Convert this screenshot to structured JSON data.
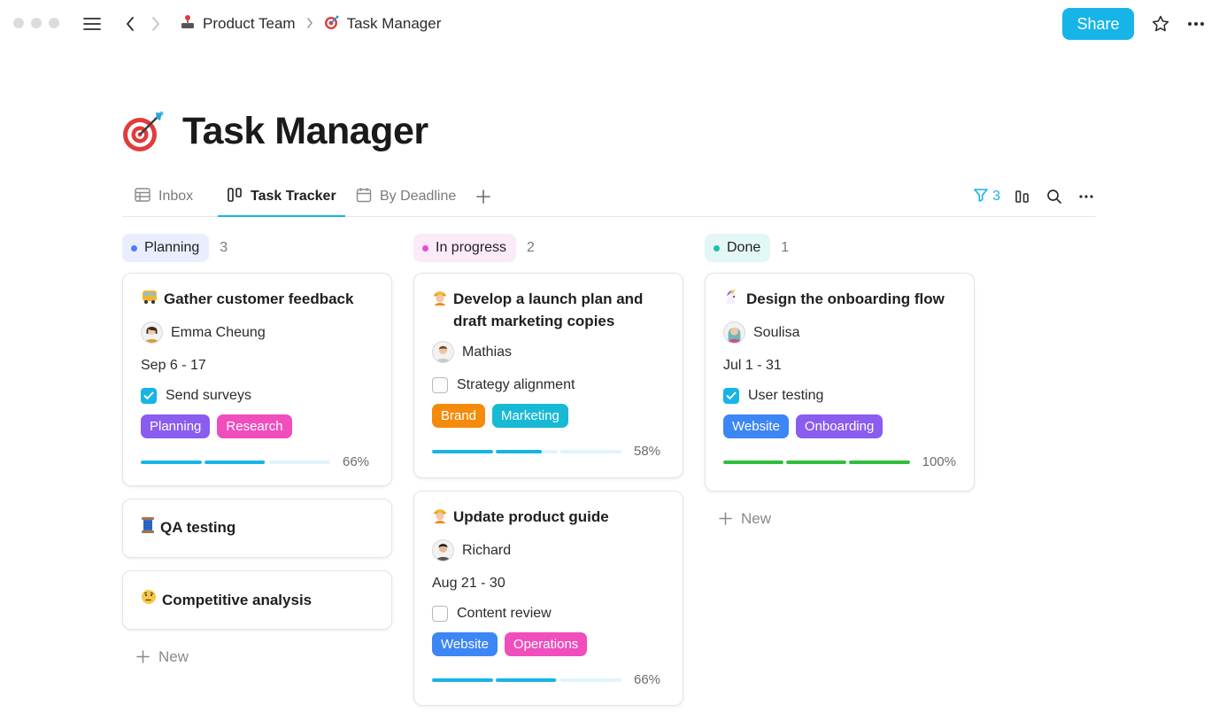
{
  "topbar": {
    "breadcrumb": [
      {
        "icon": "joystick-icon",
        "label": "Product Team"
      },
      {
        "icon": "dart-target-icon",
        "label": "Task Manager"
      }
    ],
    "share_label": "Share"
  },
  "page": {
    "icon": "dart-target-icon",
    "title": "Task Manager"
  },
  "tabs": [
    {
      "label": "Inbox",
      "icon": "table-icon",
      "active": false
    },
    {
      "label": "Task Tracker",
      "icon": "board-icon",
      "active": true
    },
    {
      "label": "By Deadline",
      "icon": "calendar-icon",
      "active": false
    }
  ],
  "toolbar": {
    "filter_count": "3"
  },
  "colors": {
    "accent": "#17b4e8",
    "progress_fill": "#17b4e8",
    "progress_track": "#e1f4fb",
    "done_fill": "#2fbf3a",
    "tag_planning": "#8a5cf0",
    "tag_research": "#f04dbd",
    "tag_brand": "#f48b0b",
    "tag_marketing": "#17b9d4",
    "tag_website": "#3d86f5",
    "tag_operations": "#f04dbd",
    "tag_onboarding": "#8a5cf0"
  },
  "columns": [
    {
      "label": "Planning",
      "count": "3",
      "pill_bg": "#e9eeff",
      "dot": "#4f79ff",
      "cards": [
        {
          "emoji": "bus-icon",
          "title": "Gather customer feedback",
          "assignee": "Emma Cheung",
          "date": "Sep 6 - 17",
          "todo": "Send surveys",
          "todo_done": true,
          "tags": [
            "Planning",
            "Research"
          ],
          "progress": "66%",
          "progress_value": 0.66
        },
        {
          "emoji": "spool-icon",
          "title": "QA testing"
        },
        {
          "emoji": "thinking-face-icon",
          "title": "Competitive analysis"
        }
      ],
      "new_label": "New"
    },
    {
      "label": "In progress",
      "count": "2",
      "pill_bg": "#fbeafa",
      "dot": "#e04fd6",
      "cards": [
        {
          "emoji": "construction-worker-icon",
          "title": "Develop a launch plan and draft marketing copies",
          "assignee": "Mathias",
          "todo": "Strategy alignment",
          "todo_done": false,
          "tags": [
            "Brand",
            "Marketing"
          ],
          "progress": "58%",
          "progress_value": 0.58
        },
        {
          "emoji": "construction-worker-icon",
          "title": "Update product guide",
          "assignee": "Richard",
          "date": "Aug 21 - 30",
          "todo": "Content review",
          "todo_done": false,
          "tags": [
            "Website",
            "Operations"
          ],
          "progress": "66%",
          "progress_value": 0.66
        }
      ]
    },
    {
      "label": "Done",
      "count": "1",
      "pill_bg": "#e3f7f5",
      "dot": "#1fbfb0",
      "cards": [
        {
          "emoji": "unicorn-icon",
          "title": "Design the onboarding flow",
          "assignee": "Soulisa",
          "date": "Jul 1 - 31",
          "todo": "User testing",
          "todo_done": true,
          "tags": [
            "Website",
            "Onboarding"
          ],
          "progress": "100%",
          "progress_value": 1.0
        }
      ],
      "new_label": "New"
    }
  ]
}
